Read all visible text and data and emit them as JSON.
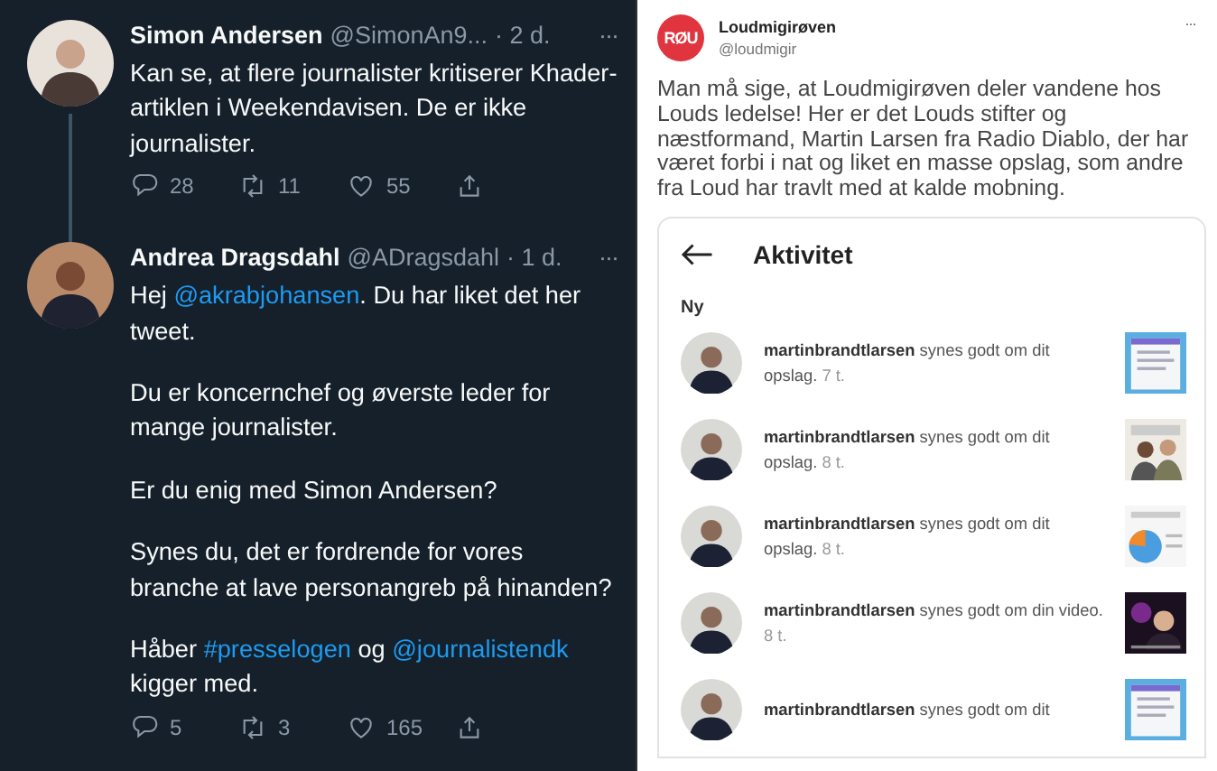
{
  "thread": [
    {
      "author": "Simon Andersen",
      "handle": "@SimonAn9...",
      "time": "· 2 d.",
      "more": "···",
      "thread_line": true,
      "paragraphs": [
        [
          {
            "kind": "plain",
            "text": "Kan se, at flere journalister kritiserer Khader-artiklen i Weekendavisen. De er ikke journalister."
          }
        ]
      ],
      "stats": {
        "replies": "28",
        "retweets": "11",
        "likes": "55"
      }
    },
    {
      "author": "Andrea Dragsdahl",
      "handle": "@ADragsdahl",
      "time": "· 1 d.",
      "more": "···",
      "thread_line": false,
      "paragraphs": [
        [
          {
            "kind": "plain",
            "text": "Hej "
          },
          {
            "kind": "link",
            "text": "@akrabjohansen"
          },
          {
            "kind": "plain",
            "text": ". Du har liket det her tweet."
          }
        ],
        [
          {
            "kind": "plain",
            "text": "Du er koncernchef og øverste leder for mange journalister."
          }
        ],
        [
          {
            "kind": "plain",
            "text": "Er du enig med Simon Andersen?"
          }
        ],
        [
          {
            "kind": "plain",
            "text": "Synes du, det er fordrende for vores branche at lave personangreb på hinanden?"
          }
        ],
        [
          {
            "kind": "plain",
            "text": "Håber "
          },
          {
            "kind": "link",
            "text": "#presselogen"
          },
          {
            "kind": "plain",
            "text": " og "
          },
          {
            "kind": "link",
            "text": "@journalistendk"
          },
          {
            "kind": "plain",
            "text": " kigger med."
          }
        ]
      ],
      "stats": {
        "replies": "5",
        "retweets": "3",
        "likes": "165"
      }
    }
  ],
  "post": {
    "logo": "RØU",
    "author": "Loudmigirøven",
    "handle": "@loudmigir",
    "more": "···",
    "text": "Man må sige, at Loudmigirøven deler vandene hos Louds ledelse! Her er det Louds stifter og næstformand, Martin Larsen fra Radio Diablo, der har været forbi i nat og liket en masse opslag, som andre fra Loud har travlt med at kalde mobning.",
    "screenshot": {
      "title": "Aktivitet",
      "section": "Ny",
      "items": [
        {
          "text": "**martinbrandtlarsen** synes godt om dit opslag.",
          "time": "7 t."
        },
        {
          "text": "**martinbrandtlarsen** synes godt om dit opslag.",
          "time": "8 t."
        },
        {
          "text": "**martinbrandtlarsen** synes godt om dit opslag.",
          "time": "8 t."
        },
        {
          "text": "**martinbrandtlarsen** synes godt om din video.",
          "time": "8 t."
        },
        {
          "text": "**martinbrandtlarsen** synes godt om dit"
        }
      ]
    }
  }
}
